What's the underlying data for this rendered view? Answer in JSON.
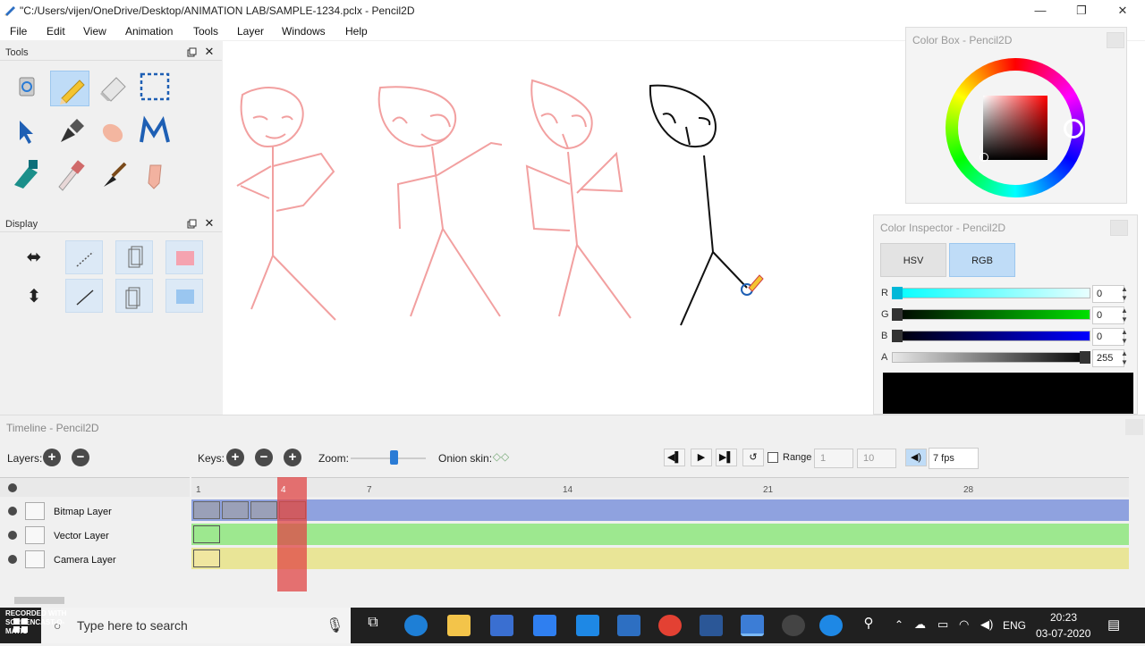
{
  "window": {
    "title": "\"C:/Users/vijen/OneDrive/Desktop/ANIMATION LAB/SAMPLE-1234.pclx - Pencil2D",
    "minimize": "—",
    "restore": "❐",
    "close": "✕"
  },
  "menu": [
    "File",
    "Edit",
    "View",
    "Animation",
    "Tools",
    "Layer",
    "Windows",
    "Help"
  ],
  "tools_panel": {
    "title": "Tools",
    "tools": [
      "clear-icon",
      "pencil-icon",
      "eraser-icon",
      "select-icon",
      "move-icon",
      "pen-icon",
      "hand-icon",
      "smudge-icon",
      "bucket-icon",
      "eyedropper-icon",
      "brush-icon",
      "polyline-icon"
    ],
    "active_tool": "pencil-icon"
  },
  "display_panel": {
    "title": "Display",
    "buttons": [
      "flip-horizontal-icon",
      "outlines-icon",
      "onion-prev-icon",
      "onion-color-prev-icon",
      "flip-vertical-icon",
      "thin-lines-icon",
      "onion-next-icon",
      "onion-color-next-icon"
    ]
  },
  "color_box": {
    "title": "Color Box - Pencil2D"
  },
  "color_inspector": {
    "title": "Color Inspector - Pencil2D",
    "tabs": [
      "HSV",
      "RGB"
    ],
    "active_tab": "RGB",
    "channels": [
      {
        "label": "R",
        "value": "0",
        "color": "#00e5ff"
      },
      {
        "label": "G",
        "value": "0",
        "color": "#00cc00"
      },
      {
        "label": "B",
        "value": "0",
        "color": "#0000ff"
      },
      {
        "label": "A",
        "value": "255",
        "color": "#000000"
      }
    ],
    "preview_color": "#000000"
  },
  "timeline": {
    "title": "Timeline - Pencil2D",
    "layers_label": "Layers:",
    "keys_label": "Keys:",
    "zoom_label": "Zoom:",
    "onion_label": "Onion skin:",
    "range_label": "Range",
    "range_start": "1",
    "range_end": "10",
    "fps": "7 fps",
    "current_frame": "4",
    "ruler_labels": [
      "1",
      "7",
      "14",
      "21",
      "28"
    ],
    "layers": [
      {
        "name": "Bitmap Layer",
        "color": "#8fa2df",
        "icon": "bitmap-layer-icon"
      },
      {
        "name": "Vector Layer",
        "color": "#9de88f",
        "icon": "vector-layer-icon"
      },
      {
        "name": "Camera Layer",
        "color": "#e9e597",
        "icon": "camera-layer-icon"
      }
    ]
  },
  "taskbar": {
    "search_placeholder": "Type here to search",
    "watermark": "RECORDED WITH SCREENCAST-O-MATIC",
    "lang": "ENG",
    "time": "20:23",
    "date": "03-07-2020"
  },
  "colors": {
    "accent": "#bfdcf7",
    "frame_highlight": "#e05555",
    "sketch": "#f2a0a0"
  }
}
